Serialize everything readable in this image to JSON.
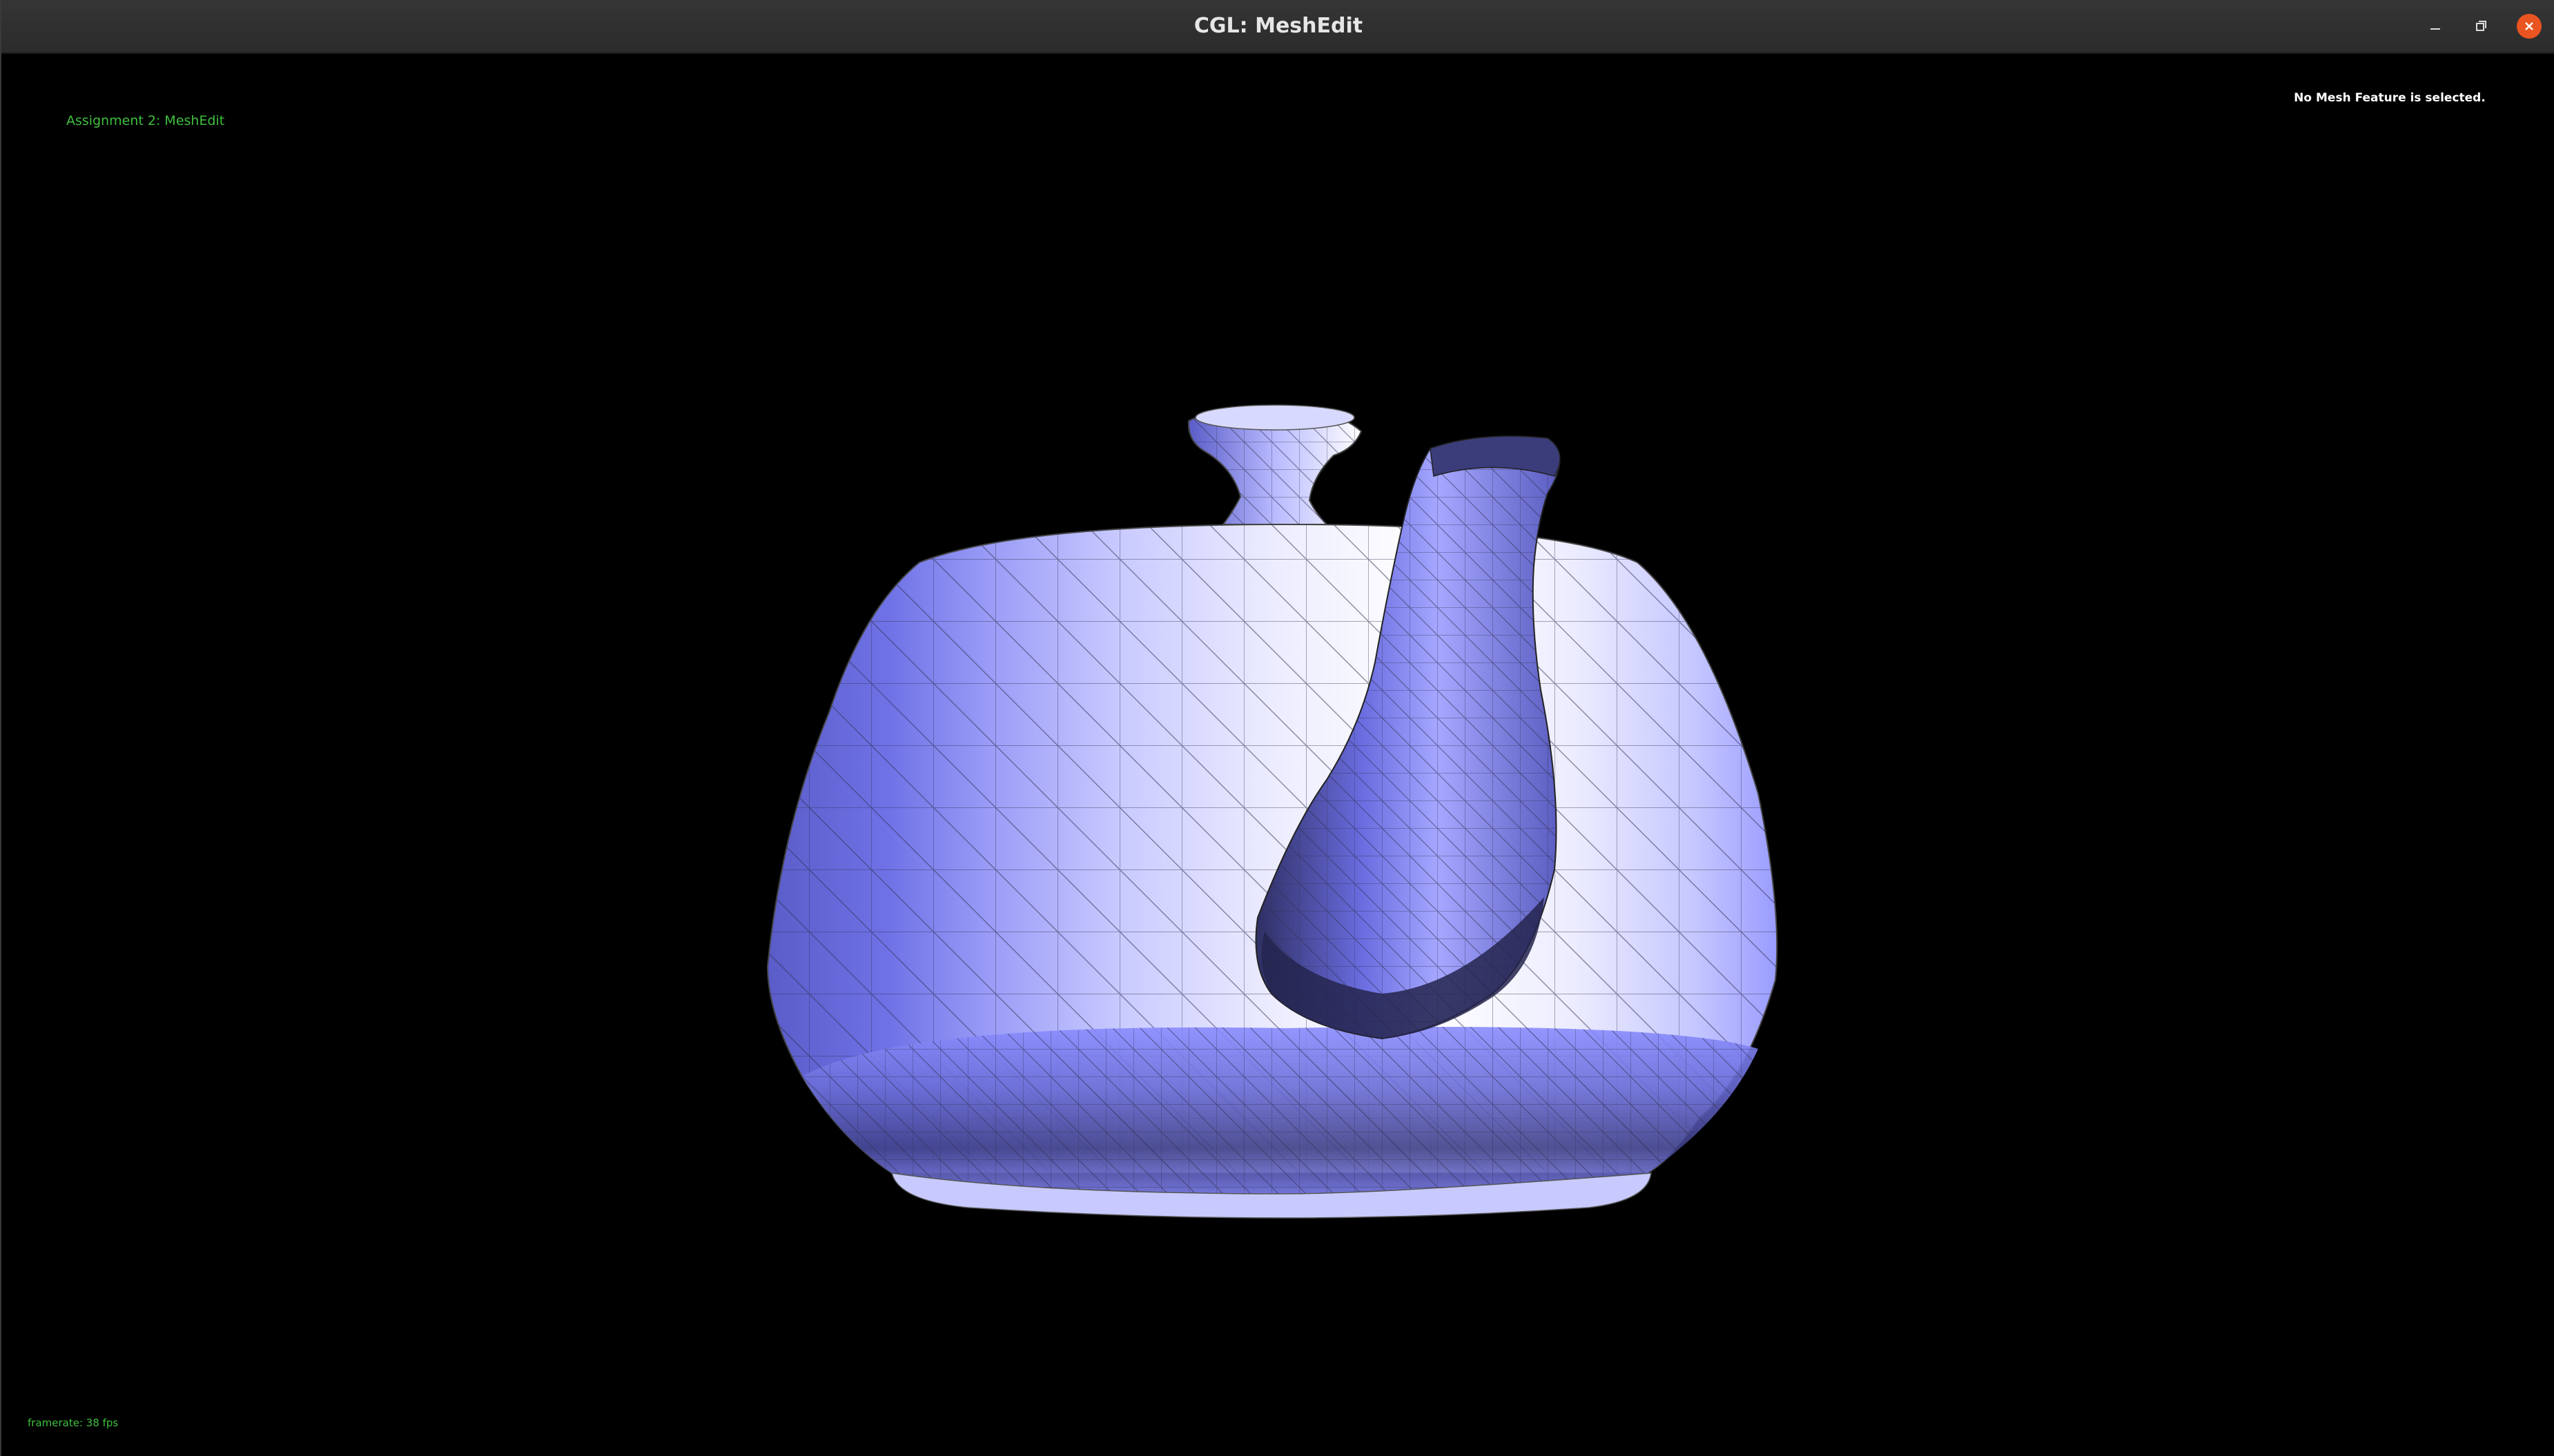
{
  "window": {
    "title": "CGL: MeshEdit",
    "buttons": {
      "minimize": "minimize-icon",
      "maximize": "restore-icon",
      "close": "close-icon"
    },
    "accent_close": "#e95420"
  },
  "viewport": {
    "hud_title": "Assignment 2: MeshEdit",
    "selection_status": "No Mesh Feature is selected.",
    "framerate": "framerate: 38 fps",
    "hud_color": "#3fbf3f",
    "background": "#000000",
    "mesh": {
      "name": "teapot",
      "base_color": "#8a8cff",
      "wireframe_color": "#3a3a5a"
    }
  }
}
